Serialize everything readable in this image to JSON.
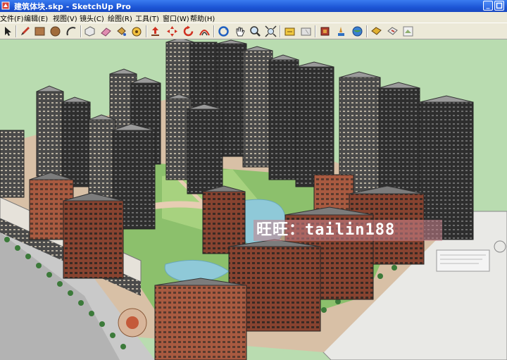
{
  "window": {
    "title": "建筑体块.skp - SketchUp Pro",
    "minimize_glyph": "_"
  },
  "menu": {
    "items": [
      {
        "label": "文件(F)"
      },
      {
        "label": "编辑(E)"
      },
      {
        "label": "视图(V)"
      },
      {
        "label": "镜头(C)"
      },
      {
        "label": "绘图(R)"
      },
      {
        "label": "工具(T)"
      },
      {
        "label": "窗口(W)"
      },
      {
        "label": "帮助(H)"
      }
    ]
  },
  "toolbar": {
    "tools": [
      "select-icon",
      "pencil-icon",
      "rectangle-icon",
      "circle-icon",
      "arc-icon",
      "make-component-icon",
      "eraser-icon",
      "paint-bucket-icon",
      "tape-measure-icon",
      "push-pull-icon",
      "move-icon",
      "rotate-icon",
      "offset-icon",
      "orbit-icon",
      "pan-icon",
      "zoom-icon",
      "zoom-extents-icon",
      "get-models-icon",
      "share-model-icon",
      "components-icon",
      "styles-icon",
      "layers-icon",
      "photo-textures-icon",
      "extension-warehouse-icon",
      "add-location-icon",
      "preview-google-earth-icon"
    ]
  },
  "viewport": {
    "watermark": "旺旺：tailin188",
    "colors": {
      "sky": "#b9dcb0",
      "ground": "#8cc06c",
      "tower": "#3a3a3a",
      "brick": "#8c4634",
      "water": "#8fc9d8",
      "plaza": "#d8b59a"
    }
  }
}
